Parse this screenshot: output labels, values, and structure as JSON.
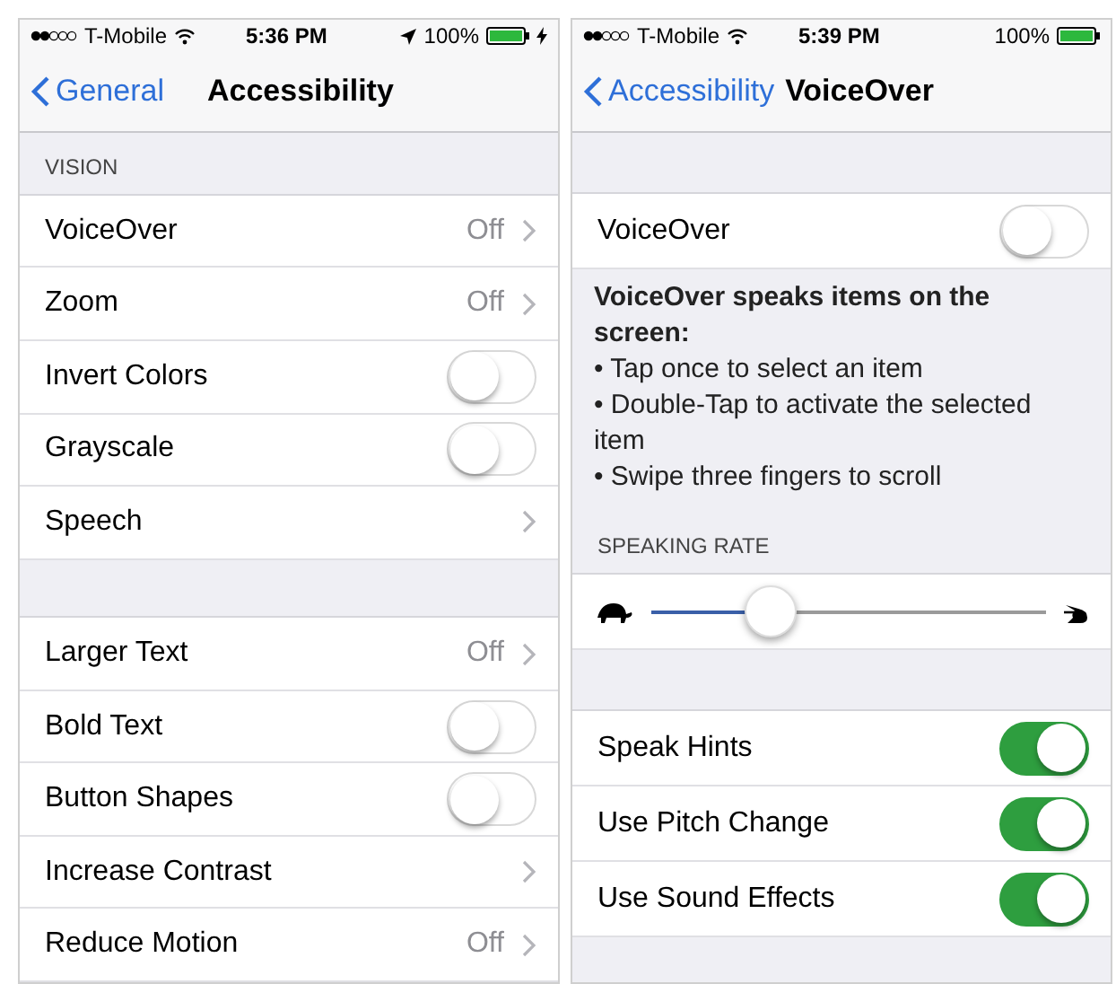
{
  "screens": [
    {
      "status_bar": {
        "carrier": "T-Mobile",
        "time": "5:36 PM",
        "location": true,
        "battery": "100%",
        "charging": true
      },
      "nav": {
        "back": "General",
        "title": "Accessibility"
      },
      "blocks": [
        {
          "kind": "header",
          "label": "VISION"
        },
        {
          "kind": "detail",
          "label": "VoiceOver",
          "value": "Off"
        },
        {
          "kind": "detail",
          "label": "Zoom",
          "value": "Off"
        },
        {
          "kind": "toggle",
          "label": "Invert Colors",
          "on": false
        },
        {
          "kind": "toggle",
          "label": "Grayscale",
          "on": false
        },
        {
          "kind": "detail",
          "label": "Speech"
        },
        {
          "kind": "spacer"
        },
        {
          "kind": "detail",
          "label": "Larger Text",
          "value": "Off"
        },
        {
          "kind": "toggle",
          "label": "Bold Text",
          "on": false
        },
        {
          "kind": "toggle",
          "label": "Button Shapes",
          "on": false
        },
        {
          "kind": "detail",
          "label": "Increase Contrast"
        },
        {
          "kind": "detail",
          "label": "Reduce Motion",
          "value": "Off"
        }
      ]
    },
    {
      "status_bar": {
        "carrier": "T-Mobile",
        "time": "5:39 PM",
        "location": false,
        "battery": "100%",
        "charging": false
      },
      "nav": {
        "back": "Accessibility",
        "title": "VoiceOver"
      },
      "blocks": [
        {
          "kind": "spacer"
        },
        {
          "kind": "toggle",
          "label": "VoiceOver",
          "on": false
        },
        {
          "kind": "note",
          "title": "VoiceOver speaks items on the screen:",
          "bullets": [
            "• Tap once to select an item",
            "• Double-Tap to activate the selected item",
            "• Swipe three fingers to scroll"
          ]
        },
        {
          "kind": "header",
          "label": "SPEAKING RATE"
        },
        {
          "kind": "slider",
          "level": 0.3
        },
        {
          "kind": "spacer"
        },
        {
          "kind": "toggle",
          "label": "Speak Hints",
          "on": true
        },
        {
          "kind": "toggle",
          "label": "Use Pitch Change",
          "on": true
        },
        {
          "kind": "toggle",
          "label": "Use Sound Effects",
          "on": true
        }
      ]
    }
  ]
}
